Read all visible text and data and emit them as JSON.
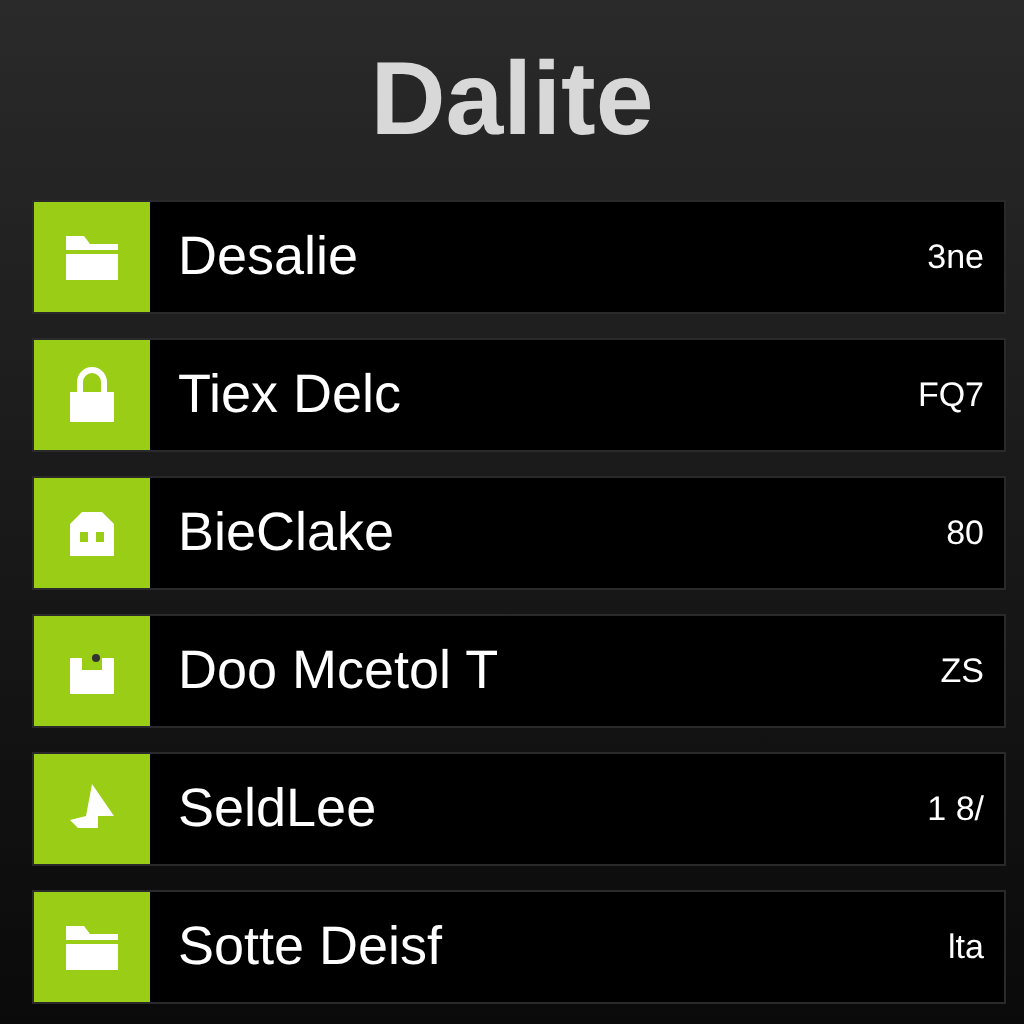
{
  "title": "Dalite",
  "items": [
    {
      "label": "Desalie",
      "value": "3ne"
    },
    {
      "label": "Tiex Delc",
      "value": "FQ7"
    },
    {
      "label": "BieClake",
      "value": "80"
    },
    {
      "label": "Doo Mcetol T",
      "value": "ZS"
    },
    {
      "label": "SeldLee",
      "value": "1 8/"
    },
    {
      "label": "Sotte Deisf",
      "value": "lta"
    }
  ]
}
